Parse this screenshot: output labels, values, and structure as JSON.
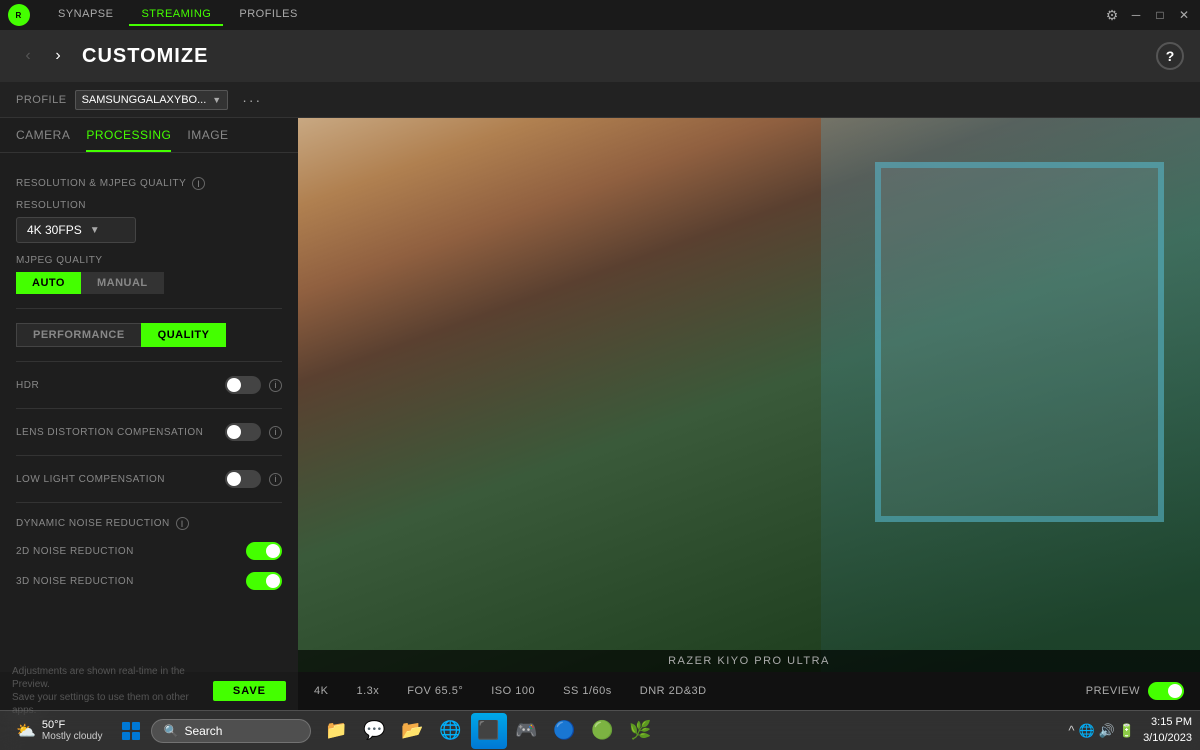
{
  "titlebar": {
    "logo_text": "R",
    "nav_tabs": [
      {
        "id": "synapse",
        "label": "SYNAPSE",
        "active": false
      },
      {
        "id": "streaming",
        "label": "STREAMING",
        "active": true
      },
      {
        "id": "profiles",
        "label": "PROFILES",
        "active": false
      }
    ],
    "gear_symbol": "⚙",
    "minimize_symbol": "─",
    "maximize_symbol": "□",
    "close_symbol": "✕"
  },
  "header": {
    "back_symbol": "‹",
    "forward_symbol": "›",
    "title": "CUSTOMIZE",
    "help_symbol": "?"
  },
  "profile": {
    "label": "PROFILE",
    "selected": "SAMSUNGGALAXYBO...",
    "chevron": "▼",
    "more_symbol": "···"
  },
  "tabs": {
    "camera": "CAMERA",
    "processing": "PROCESSING",
    "image": "IMAGE"
  },
  "settings": {
    "resolution_quality_title": "RESOLUTION & MJPEG QUALITY",
    "resolution_label": "RESOLUTION",
    "resolution_value": "4K 30FPS",
    "resolution_chevron": "▼",
    "mjpeg_label": "MJPEG QUALITY",
    "auto_label": "AUTO",
    "manual_label": "MANUAL",
    "performance_label": "PERFORMANCE",
    "quality_label": "QUALITY",
    "hdr_label": "HDR",
    "hdr_info": "i",
    "lens_label": "LENS DISTORTION COMPENSATION",
    "lens_info": "i",
    "lowlight_label": "LOW LIGHT COMPENSATION",
    "lowlight_info": "i",
    "dnr_title": "DYNAMIC NOISE REDUCTION",
    "dnr_info": "i",
    "noise2d_label": "2D NOISE REDUCTION",
    "noise3d_label": "3D NOISE REDUCTION"
  },
  "toggles": {
    "hdr": "off",
    "lens_distortion": "off",
    "low_light": "off",
    "noise2d": "on",
    "noise3d": "on",
    "preview": "on"
  },
  "bottom_bar": {
    "resolution": "4K",
    "zoom": "1.3x",
    "fov": "FOV 65.5°",
    "iso": "ISO 100",
    "ss": "SS 1/60s",
    "dnr": "DNR 2D&3D",
    "preview_label": "PREVIEW"
  },
  "action_bar": {
    "hint_line1": "Adjustments are shown real-time in the Preview.",
    "hint_line2": "Save your settings to use them on other apps.",
    "save_label": "SAVE"
  },
  "camera_name": "RAZER KIYO PRO ULTRA",
  "taskbar": {
    "weather_temp": "50°F",
    "weather_desc": "Mostly cloudy",
    "search_placeholder": "Search",
    "time": "3:15 PM",
    "date": "3/10/2023",
    "start_symbol": "⊞",
    "chevron_up": "^",
    "apps": [
      "⬛",
      "🟫",
      "📁",
      "🌐",
      "⬛",
      "🟩",
      "🔵",
      "🔷",
      "🟢",
      "🌿"
    ]
  }
}
